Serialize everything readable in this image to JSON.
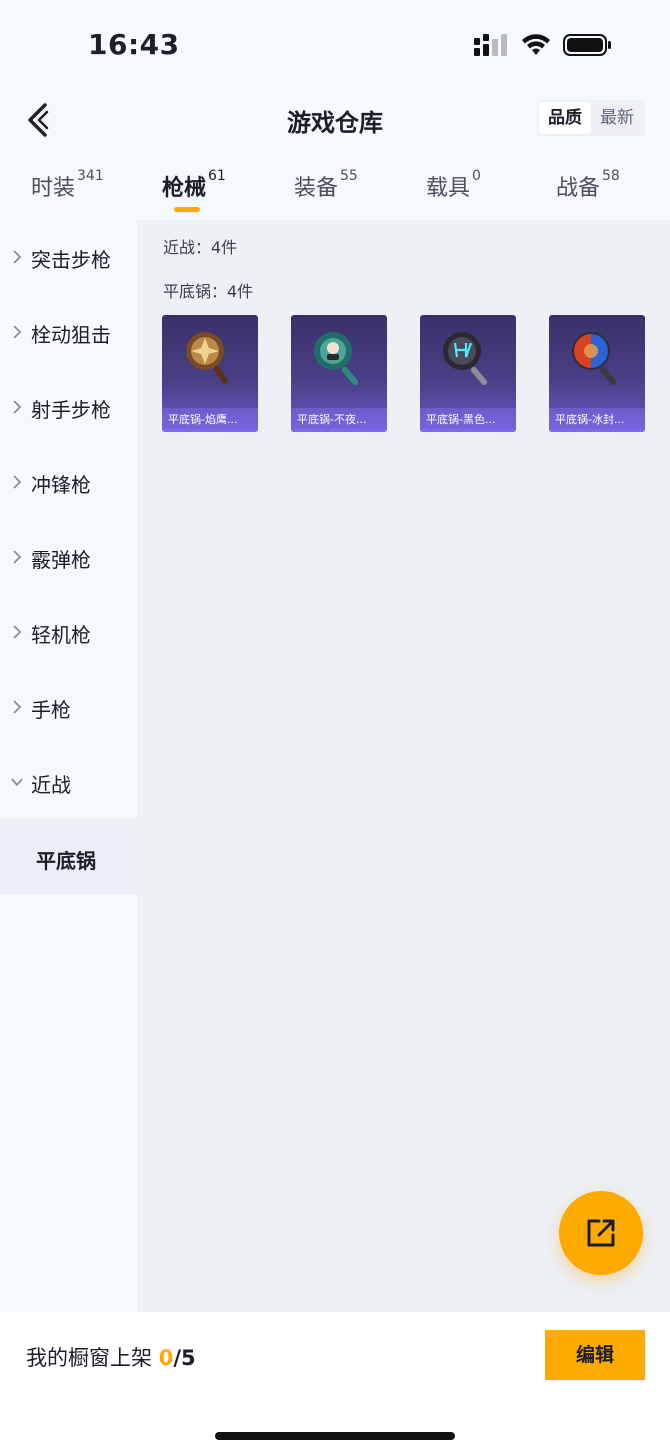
{
  "status": {
    "time": "16:43"
  },
  "nav": {
    "title": "游戏仓库",
    "sort_options": [
      {
        "label": "品质",
        "active": true
      },
      {
        "label": "最新",
        "active": false
      }
    ]
  },
  "tabs": [
    {
      "label": "时装",
      "count": "341",
      "active": false
    },
    {
      "label": "枪械",
      "count": "61",
      "active": true
    },
    {
      "label": "装备",
      "count": "55",
      "active": false
    },
    {
      "label": "载具",
      "count": "0",
      "active": false
    },
    {
      "label": "战备",
      "count": "58",
      "active": false
    }
  ],
  "sidebar": {
    "items": [
      {
        "label": "突击步枪",
        "expanded": false
      },
      {
        "label": "栓动狙击",
        "expanded": false
      },
      {
        "label": "射手步枪",
        "expanded": false
      },
      {
        "label": "冲锋枪",
        "expanded": false
      },
      {
        "label": "霰弹枪",
        "expanded": false
      },
      {
        "label": "轻机枪",
        "expanded": false
      },
      {
        "label": "手枪",
        "expanded": false
      },
      {
        "label": "近战",
        "expanded": true
      }
    ],
    "sub_items": [
      {
        "label": "平底锅",
        "selected": true
      }
    ]
  },
  "content": {
    "category_summary": "近战：4件",
    "subcategory_summary": "平底锅：4件",
    "items": [
      {
        "caption": "平底锅-焰鹰...",
        "icon": "frying-pan-gold-icon"
      },
      {
        "caption": "平底锅-不夜...",
        "icon": "frying-pan-teal-icon"
      },
      {
        "caption": "平底锅-黑色...",
        "icon": "frying-pan-neon-icon"
      },
      {
        "caption": "平底锅-冰封...",
        "icon": "frying-pan-fire-ice-icon"
      }
    ]
  },
  "footer": {
    "shelf_label": "我的橱窗上架",
    "shelf_count": "0",
    "shelf_total": "/5",
    "edit_label": "编辑"
  },
  "colors": {
    "accent": "#ffaa00",
    "card_bg": "#3a3069",
    "page_bg": "#f5f8fd",
    "content_bg": "#edf0f5"
  }
}
